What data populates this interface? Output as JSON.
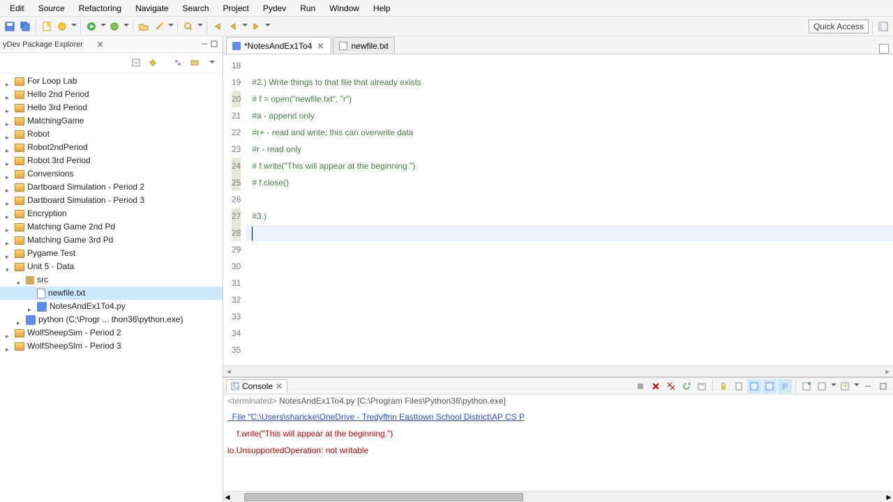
{
  "menubar": [
    "Edit",
    "Source",
    "Refactoring",
    "Navigate",
    "Search",
    "Project",
    "Pydev",
    "Run",
    "Window",
    "Help"
  ],
  "quick_access": "Quick Access",
  "sidebar": {
    "title": "yDev Package Explorer",
    "items": [
      {
        "label": "For Loop Lab",
        "type": "proj",
        "depth": 0,
        "twisty": "collapsed"
      },
      {
        "label": "Hello 2nd Period",
        "type": "proj",
        "depth": 0,
        "twisty": "collapsed"
      },
      {
        "label": "Hello 3rd Period",
        "type": "proj",
        "depth": 0,
        "twisty": "collapsed"
      },
      {
        "label": "MatchingGame",
        "type": "proj",
        "depth": 0,
        "twisty": "collapsed"
      },
      {
        "label": "Robot",
        "type": "proj",
        "depth": 0,
        "twisty": "collapsed"
      },
      {
        "label": "Robot2ndPeriod",
        "type": "proj",
        "depth": 0,
        "twisty": "collapsed"
      },
      {
        "label": "Robot 3rd Period",
        "type": "proj",
        "depth": 0,
        "twisty": "collapsed"
      },
      {
        "label": "Conversions",
        "type": "proj",
        "depth": 0,
        "twisty": "collapsed"
      },
      {
        "label": "Dartboard Simulation - Period 2",
        "type": "proj",
        "depth": 0,
        "twisty": "collapsed"
      },
      {
        "label": "Dartboard Simulation - Period 3",
        "type": "proj",
        "depth": 0,
        "twisty": "collapsed"
      },
      {
        "label": "Encryption",
        "type": "proj",
        "depth": 0,
        "twisty": "collapsed"
      },
      {
        "label": "Matching Game 2nd Pd",
        "type": "proj",
        "depth": 0,
        "twisty": "collapsed"
      },
      {
        "label": "Matching Game 3rd Pd",
        "type": "proj",
        "depth": 0,
        "twisty": "collapsed"
      },
      {
        "label": "Pygame Test",
        "type": "proj",
        "depth": 0,
        "twisty": "collapsed"
      },
      {
        "label": "Unit 5 - Data",
        "type": "proj",
        "depth": 0,
        "twisty": "expanded"
      },
      {
        "label": "src",
        "type": "pkg",
        "depth": 1,
        "twisty": "expanded"
      },
      {
        "label": "newfile.txt",
        "type": "file",
        "depth": 2,
        "twisty": "",
        "selected": true
      },
      {
        "label": "NotesAndEx1To4.py",
        "type": "py",
        "depth": 2,
        "twisty": "collapsed"
      },
      {
        "label": "python  (C:\\Progr ... thon36\\python.exe)",
        "type": "py",
        "depth": 1,
        "twisty": "collapsed"
      },
      {
        "label": "WolfSheepSim - Period 2",
        "type": "proj",
        "depth": 0,
        "twisty": "collapsed"
      },
      {
        "label": "WolfSheepSlm - Period 3",
        "type": "proj",
        "depth": 0,
        "twisty": "collapsed"
      }
    ]
  },
  "editor": {
    "tabs": [
      {
        "label": "*NotesAndEx1To4",
        "active": true,
        "icon": "py"
      },
      {
        "label": "newfile.txt",
        "active": false,
        "icon": "file"
      }
    ],
    "first_line": 18,
    "highlighted_gutter": [
      20,
      24,
      25,
      27,
      28
    ],
    "current_line": 28,
    "lines": [
      "",
      "#2.) Write things to that file that already exists",
      "# f = open(\"newfile.txt\", \"r\")",
      "#a - append only",
      "#r+ - read and write; this can overwrite data",
      "#r - read only",
      "# f.write(\"This will appear at the beginning.\")",
      "# f.close()",
      "",
      "#3.)",
      "",
      "",
      "",
      "",
      "",
      "",
      "",
      ""
    ]
  },
  "console": {
    "title": "Console",
    "status_prefix": "<terminated>",
    "status": " NotesAndEx1To4.py [C:\\Program Files\\Python36\\python.exe]",
    "lines": [
      {
        "text": "  File \"C:\\Users\\sharicke\\OneDrive - Tredyffrin Easttown School District\\AP CS P",
        "cls": "trace"
      },
      {
        "text": "    f.write(\"This will appear at the beginning.\")",
        "cls": "err"
      },
      {
        "text": "io.UnsupportedOperation: not writable",
        "cls": "err"
      }
    ]
  }
}
